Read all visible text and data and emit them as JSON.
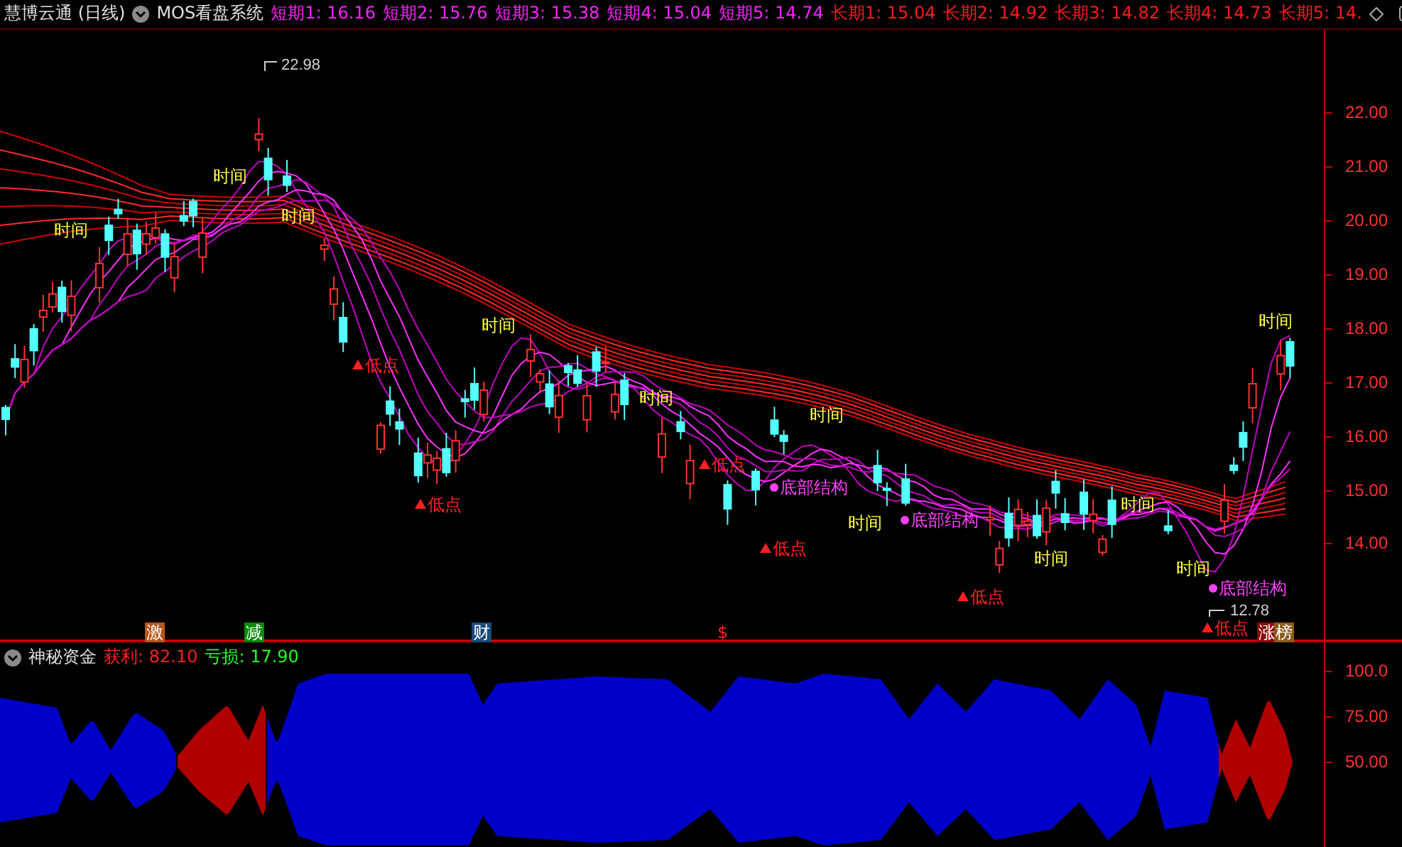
{
  "header": {
    "title": "慧博云通 (日线)",
    "indicator": "MOS看盘系统",
    "values": [
      {
        "kind": "short",
        "label": "短期1: 16.16"
      },
      {
        "kind": "short",
        "label": "短期2: 15.76"
      },
      {
        "kind": "short",
        "label": "短期3: 15.38"
      },
      {
        "kind": "short",
        "label": "短期4: 15.04"
      },
      {
        "kind": "short",
        "label": "短期5: 14.74"
      },
      {
        "kind": "long",
        "label": "长期1: 15.04"
      },
      {
        "kind": "long",
        "label": "长期2: 14.92"
      },
      {
        "kind": "long",
        "label": "长期3: 14.82"
      },
      {
        "kind": "long",
        "label": "长期4: 14.73"
      },
      {
        "kind": "long",
        "label": "长期5: 14."
      }
    ]
  },
  "price_chart": {
    "high_label": "22.98",
    "low_label": "12.78",
    "y_axis": [
      "22.00",
      "21.00",
      "20.00",
      "19.00",
      "18.00",
      "17.00",
      "16.00",
      "15.00",
      "14.00"
    ],
    "signals": [
      {
        "kind": "time",
        "text": "时间"
      },
      {
        "kind": "time",
        "text": "时间"
      },
      {
        "kind": "time",
        "text": "时间"
      },
      {
        "kind": "time",
        "text": "时间"
      },
      {
        "kind": "time",
        "text": "时间"
      },
      {
        "kind": "time",
        "text": "时间"
      },
      {
        "kind": "time",
        "text": "时间"
      },
      {
        "kind": "time",
        "text": "时间"
      },
      {
        "kind": "time",
        "text": "时间"
      },
      {
        "kind": "time",
        "text": "时间"
      },
      {
        "kind": "time",
        "text": "时间"
      },
      {
        "kind": "low",
        "text": "低点"
      },
      {
        "kind": "low",
        "text": "低点"
      },
      {
        "kind": "low",
        "text": "低点"
      },
      {
        "kind": "low",
        "text": "低点"
      },
      {
        "kind": "low",
        "text": "低点"
      },
      {
        "kind": "low",
        "text": "低点"
      },
      {
        "kind": "bottom",
        "text": "底部结构"
      },
      {
        "kind": "bottom",
        "text": "底部结构"
      },
      {
        "kind": "bottom",
        "text": "底部结构"
      }
    ],
    "markers": [
      {
        "kind": "tag",
        "text": "激",
        "color": "#b5561b"
      },
      {
        "kind": "tag",
        "text": "减",
        "color": "#0a8a0a"
      },
      {
        "kind": "tag",
        "text": "财",
        "color": "#1a4a7a"
      },
      {
        "kind": "symbol",
        "text": "$",
        "color": "#ff2020"
      },
      {
        "kind": "tag",
        "text": "涨",
        "color": "#8b0a0a"
      },
      {
        "kind": "tag",
        "text": "榜",
        "color": "#8b5a1a"
      }
    ]
  },
  "sub_panel": {
    "title": "神秘资金",
    "profit": "获利: 82.10",
    "loss": "亏损: 17.90",
    "y_axis": [
      "100.0",
      "75.00",
      "50.00"
    ]
  }
}
